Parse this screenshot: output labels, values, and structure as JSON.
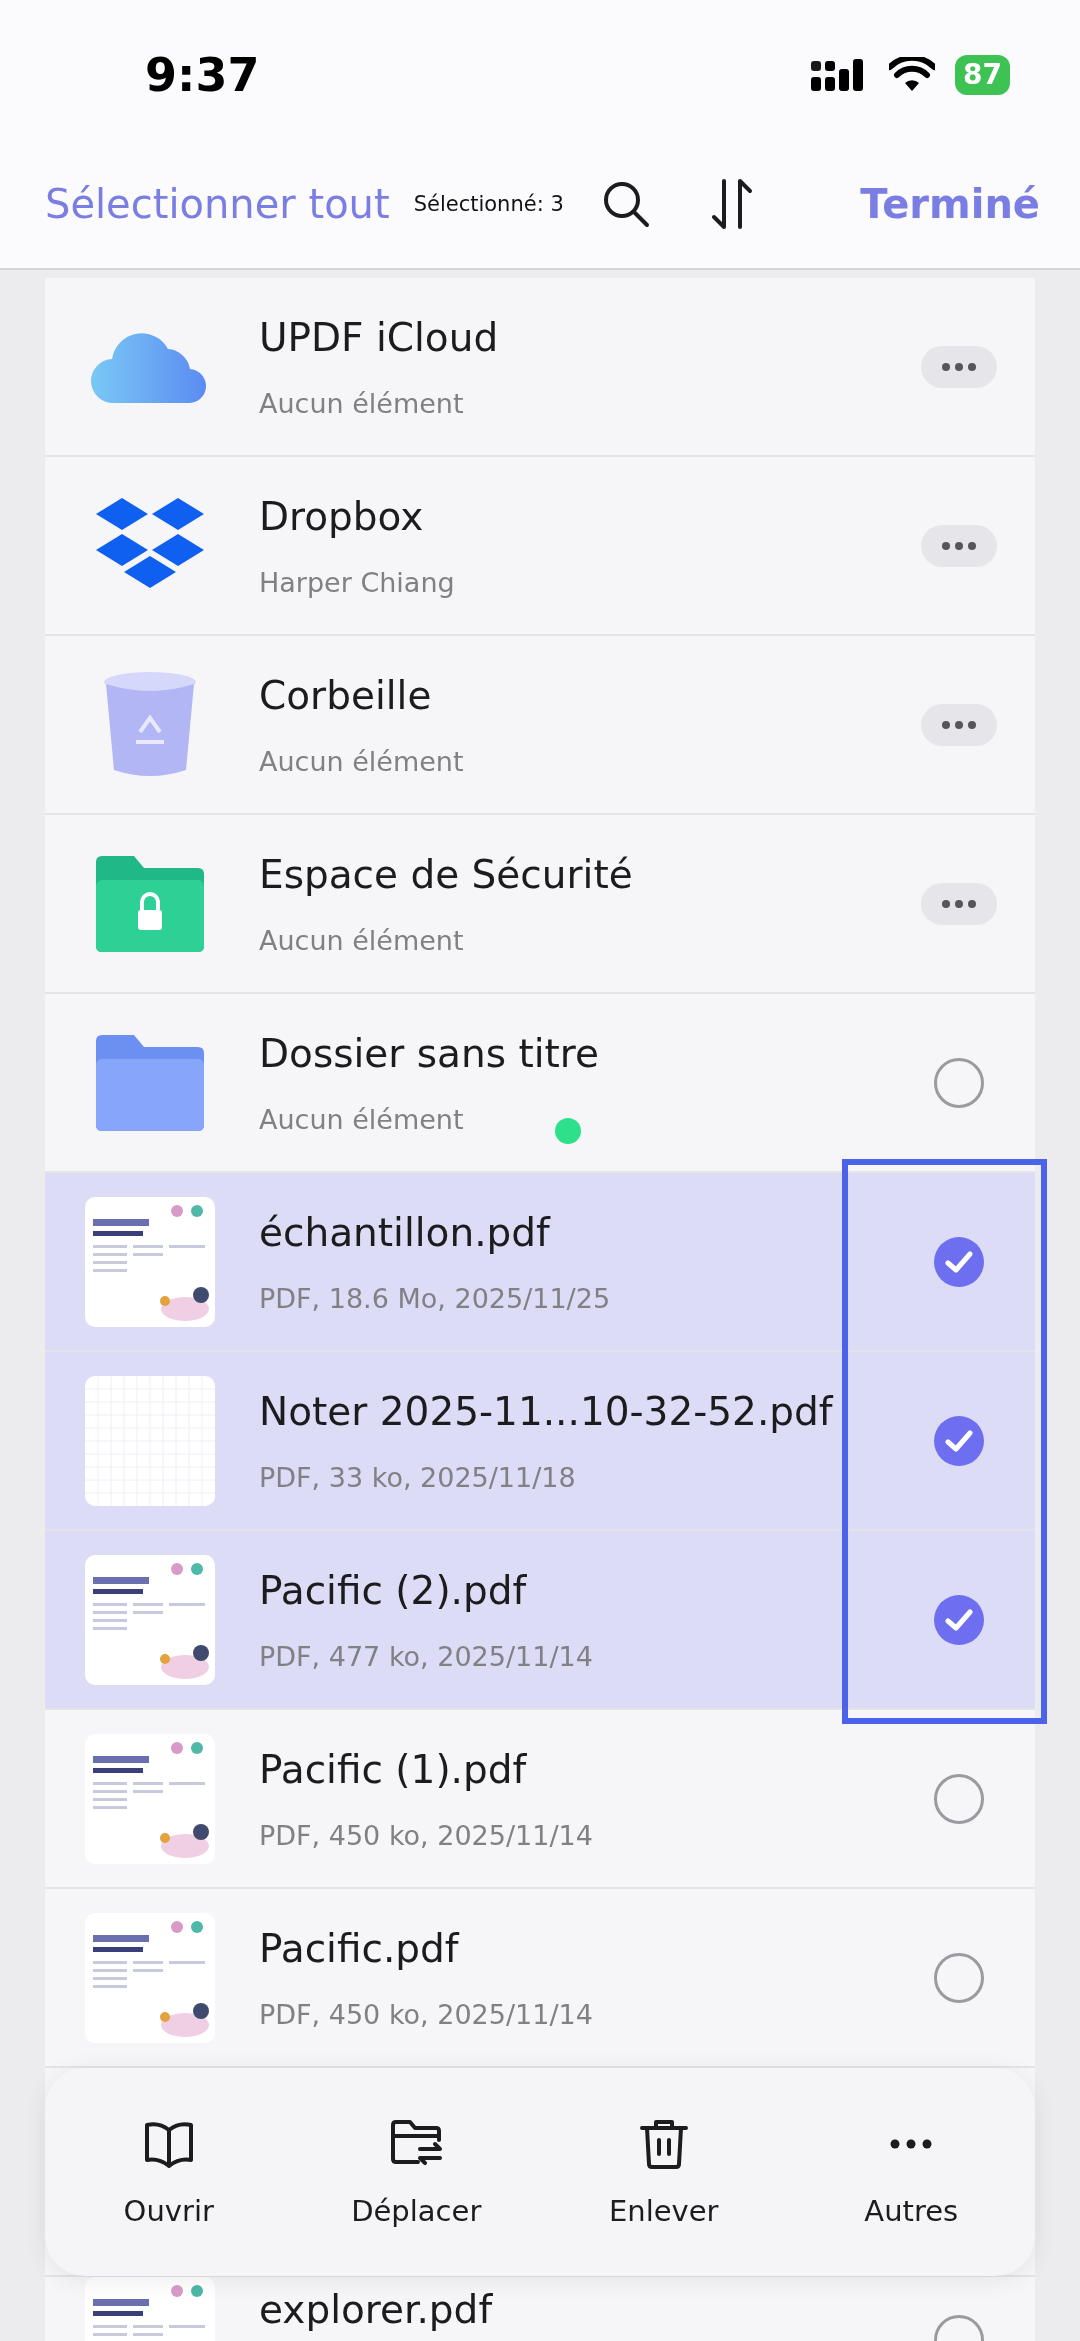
{
  "status_bar": {
    "time": "9:37",
    "battery": "87"
  },
  "nav": {
    "select_all": "Sélectionner tout",
    "count": "Sélectionné: 3",
    "done": "Terminé"
  },
  "rows": [
    {
      "kind": "cloud",
      "title": "UPDF iCloud",
      "subtitle": "Aucun élément"
    },
    {
      "kind": "dropbox",
      "title": "Dropbox",
      "subtitle": "Harper Chiang"
    },
    {
      "kind": "trash",
      "title": "Corbeille",
      "subtitle": "Aucun élément"
    },
    {
      "kind": "vault",
      "title": "Espace de Sécurité",
      "subtitle": "Aucun élément"
    },
    {
      "kind": "folder",
      "title": "Dossier sans titre",
      "subtitle": "Aucun élément",
      "selected": false,
      "sync_dot": true
    },
    {
      "kind": "document",
      "title": "échantillon.pdf",
      "subtitle": "PDF, 18.6 Mo, 2025/11/25",
      "selected": true
    },
    {
      "kind": "blank",
      "title": "Noter 2025-11...10-32-52.pdf",
      "subtitle": "PDF, 33 ko, 2025/11/18",
      "selected": true
    },
    {
      "kind": "document",
      "title": "Pacific (2).pdf",
      "subtitle": "PDF, 477 ko, 2025/11/14",
      "selected": true
    },
    {
      "kind": "document",
      "title": "Pacific (1).pdf",
      "subtitle": "PDF, 450 ko, 2025/11/14",
      "selected": false
    },
    {
      "kind": "document",
      "title": "Pacific.pdf",
      "subtitle": "PDF, 450 ko, 2025/11/14",
      "selected": false
    },
    {
      "kind": "document",
      "title": "explorer.pdf",
      "selected": false
    }
  ],
  "annotation": {
    "kind": "frame"
  },
  "toolbar": [
    {
      "kind": "open",
      "label": "Ouvrir"
    },
    {
      "kind": "move",
      "label": "Déplacer"
    },
    {
      "kind": "remove",
      "label": "Enlever"
    },
    {
      "kind": "more",
      "label": "Autres"
    }
  ]
}
